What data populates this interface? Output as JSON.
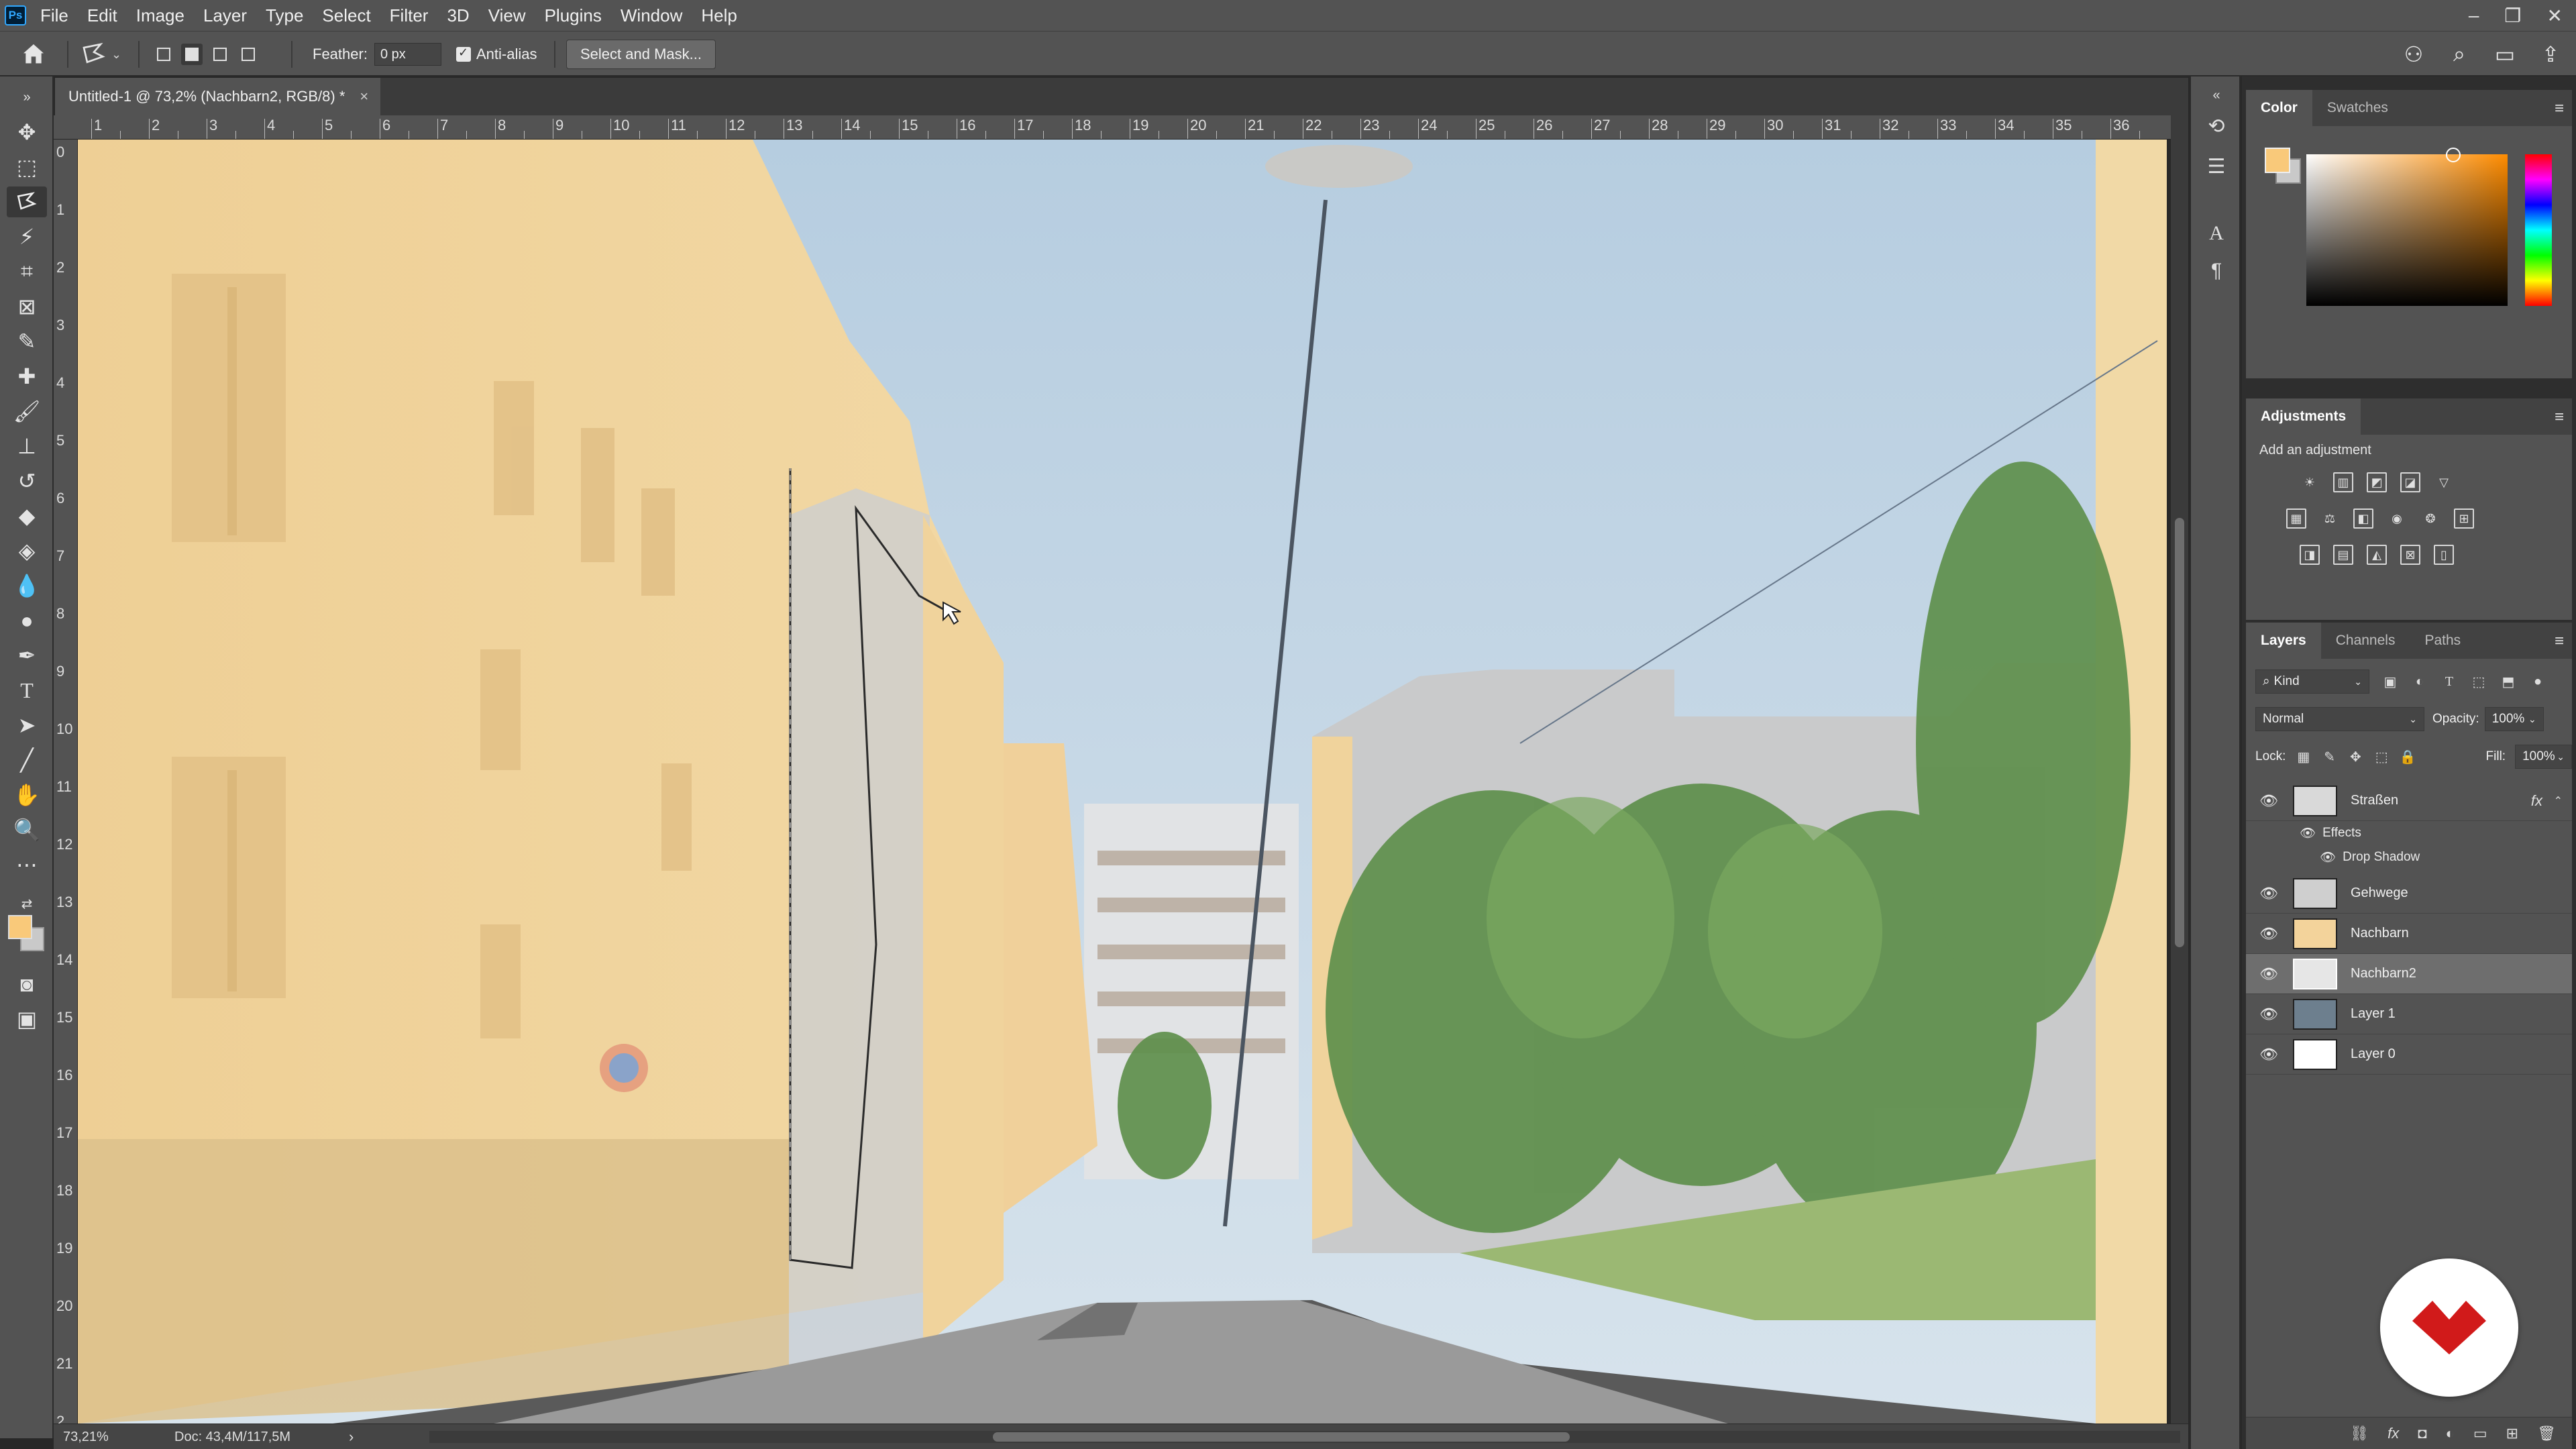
{
  "app": {
    "logo": "Ps",
    "menu": [
      "File",
      "Edit",
      "Image",
      "Layer",
      "Type",
      "Select",
      "Filter",
      "3D",
      "View",
      "Plugins",
      "Window",
      "Help"
    ]
  },
  "options": {
    "feather_label": "Feather:",
    "feather_value": "0 px",
    "antialias_label": "Anti-alias",
    "select_mask_label": "Select and Mask..."
  },
  "document": {
    "tab_title": "Untitled-1 @ 73,2% (Nachbarn2, RGB/8) *",
    "close_glyph": "×"
  },
  "rulers": {
    "top": [
      "1",
      "2",
      "3",
      "4",
      "5",
      "6",
      "7",
      "8",
      "9",
      "10",
      "11",
      "12",
      "13",
      "14",
      "15",
      "16",
      "17",
      "18",
      "19",
      "20",
      "21",
      "22",
      "23",
      "24",
      "25",
      "26",
      "27",
      "28",
      "29",
      "30",
      "31",
      "32",
      "33",
      "34",
      "35",
      "36"
    ],
    "left": [
      "0",
      "1",
      "2",
      "3",
      "4",
      "5",
      "6",
      "7",
      "8",
      "9",
      "10",
      "11",
      "12",
      "13",
      "14",
      "15",
      "16",
      "17",
      "18",
      "19",
      "20",
      "21",
      "2"
    ]
  },
  "status": {
    "zoom": "73,21%",
    "doc": "Doc: 43,4M/117,5M"
  },
  "color_panel": {
    "tabs": [
      "Color",
      "Swatches"
    ],
    "foreground": "#f9c97a",
    "background": "#c9c9c9"
  },
  "adjustments_panel": {
    "title": "Adjustments",
    "subtitle": "Add an adjustment"
  },
  "layers_panel": {
    "tabs": [
      "Layers",
      "Channels",
      "Paths"
    ],
    "filter_label": "Kind",
    "blend_mode": "Normal",
    "opacity_label": "Opacity:",
    "opacity_value": "100%",
    "lock_label": "Lock:",
    "fill_label": "Fill:",
    "fill_value": "100%",
    "layers": [
      {
        "name": "Straßen",
        "thumb": "#d9d9d9",
        "fx": "fx"
      },
      {
        "name": "Gehwege",
        "thumb": "#cfcfcf"
      },
      {
        "name": "Nachbarn",
        "thumb": "#f3d39b"
      },
      {
        "name": "Nachbarn2",
        "thumb": "#e6e6e6",
        "selected": true
      },
      {
        "name": "Layer 1",
        "thumb": "#6d7f8e"
      },
      {
        "name": "Layer 0",
        "thumb": "#ffffff"
      }
    ],
    "effects_label": "Effects",
    "drop_shadow_label": "Drop Shadow"
  }
}
